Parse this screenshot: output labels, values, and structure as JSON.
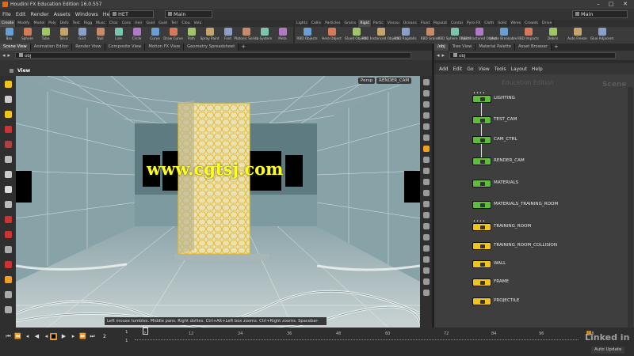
{
  "titlebar": {
    "title": "Houdini FX Education Edition 16.0.557",
    "minimize": "–",
    "maximize": "□",
    "close": "✕"
  },
  "menubar": {
    "items": [
      "File",
      "Edit",
      "Render",
      "Assets",
      "Windows",
      "Help"
    ],
    "desktop": "HET",
    "context": "Main",
    "context_right": "Main"
  },
  "shelf_left": {
    "tabs": [
      "Create",
      "Modify",
      "Model",
      "Poly",
      "Defo",
      "Text",
      "Rigg",
      "Musc",
      "Char",
      "Cons",
      "Hair",
      "Guid",
      "Guid",
      "Terr",
      "Clou",
      "Volu"
    ],
    "active_tab": 0,
    "tools": [
      "Box",
      "Sphere",
      "Tube",
      "Torus",
      "Grid",
      "Null",
      "Line",
      "Circle",
      "Curve",
      "Draw Curve",
      "Path",
      "Spray Paint",
      "Font",
      "Platonic Solids",
      "L-System",
      "Meta"
    ]
  },
  "shelf_right": {
    "tabs": [
      "Lights",
      "Collis",
      "Particles",
      "Grains",
      "Rigid",
      "Partic",
      "Viscou",
      "Oceans",
      "Fluid",
      "Populat",
      "Contai",
      "Pyro FX",
      "Cloth",
      "Solid",
      "Wires",
      "Crowds",
      "Drive"
    ],
    "active_tab": 4,
    "tools": [
      "RBD Objects",
      "Hero Object",
      "Glued Objects",
      "RBD Instanced Objects",
      "RBD Ragdolls",
      "RBD Grains",
      "RBD Sphere Objects",
      "RBD Fractured Object",
      "Make Breakable",
      "RBD Impacts",
      "Debris",
      "Auto Freeze",
      "Glue Adjacent"
    ]
  },
  "left_pane": {
    "tabs": [
      "Scene View",
      "Animation Editor",
      "Render View",
      "Composite View",
      "Motion FX View",
      "Geometry Spreadsheet"
    ],
    "path": "obj",
    "view_label": "View",
    "persp": "Persp",
    "camera": "RENDER_CAM",
    "hint": "Left mouse tumbles. Middle pans. Right dollies. Ctrl+Alt+Left box zooms. Ctrl+Right zooms. Spacebar-Ctrl-Left tilts."
  },
  "right_pane": {
    "tabs": [
      "/obj",
      "Tree View",
      "Material Palette",
      "Asset Browser"
    ],
    "path": "obj",
    "menu": [
      "Add",
      "Edit",
      "Go",
      "View",
      "Tools",
      "Layout",
      "Help"
    ],
    "edition": "Education Edition",
    "context_label": "Scene",
    "nodes": [
      {
        "name": "LIGHTING",
        "color": "green"
      },
      {
        "name": "TEST_CAM",
        "color": "green"
      },
      {
        "name": "CAM_CTRL",
        "color": "green"
      },
      {
        "name": "RENDER_CAM",
        "color": "green"
      },
      {
        "name": "MATERIALS",
        "color": "green"
      },
      {
        "name": "MATERIALS_TRAINING_ROOM",
        "color": "green"
      },
      {
        "name": "TRAINING_ROOM",
        "color": "yellow"
      },
      {
        "name": "TRAINING_ROOM_COLLISION",
        "color": "yellow"
      },
      {
        "name": "WALL",
        "color": "yellow"
      },
      {
        "name": "FRAME",
        "color": "yellow"
      },
      {
        "name": "PROJECTILE",
        "color": "yellow"
      }
    ]
  },
  "watermark": "www.cgtsj.com",
  "playbar": {
    "frame": "2",
    "start": "1",
    "start2": "1",
    "ticks": [
      "2",
      "12",
      "24",
      "36",
      "48",
      "60",
      "72",
      "84",
      "96",
      "108"
    ],
    "auto_update": "Auto Update",
    "brand": "Linked in"
  },
  "colors": {
    "node_green": "#5fbd3a",
    "node_yellow": "#f0c418",
    "accent": "#f0a020"
  }
}
